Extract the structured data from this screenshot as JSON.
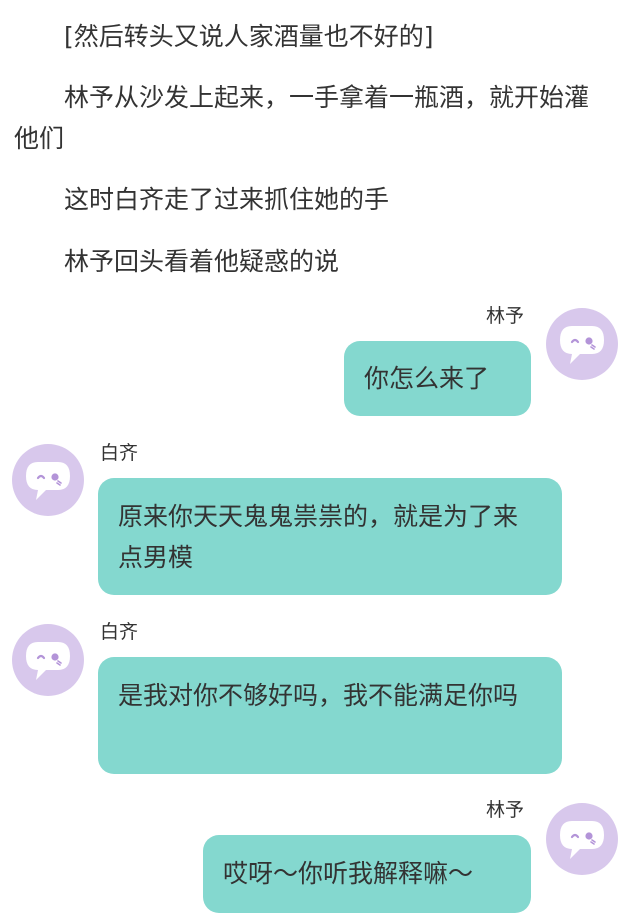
{
  "narration": [
    "[然后转头又说人家酒量也不好的]",
    "林予从沙发上起来，一手拿着一瓶酒，就开始灌他们",
    "这时白齐走了过来抓住她的手",
    "林予回头看着他疑惑的说"
  ],
  "messages": [
    {
      "speaker": "林予",
      "side": "right",
      "text": "你怎么来了"
    },
    {
      "speaker": "白齐",
      "side": "left",
      "text": "原来你天天鬼鬼祟祟的，就是为了来点男模"
    },
    {
      "speaker": "白齐",
      "side": "left",
      "text": "是我对你不够好吗，我不能满足你吗"
    },
    {
      "speaker": "林予",
      "side": "right",
      "text": "哎呀～你听我解释嘛～"
    }
  ],
  "avatar_icon": "chat-bubble-face-icon",
  "colors": {
    "bubble": "#84d8cf",
    "avatar": "#d8c8ec",
    "text": "#333333"
  }
}
